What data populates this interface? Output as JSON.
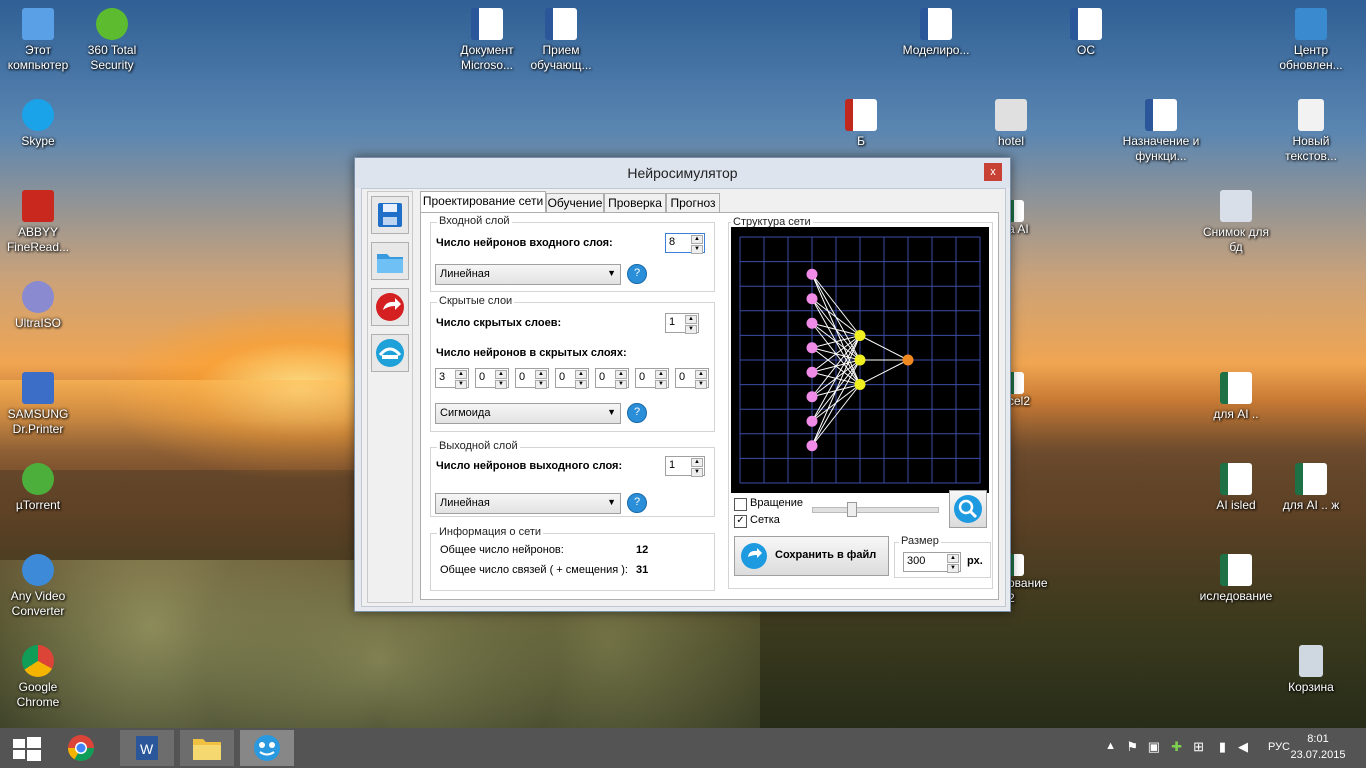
{
  "desktop": {
    "icons": [
      {
        "label": "Этот компьютер",
        "color": "#5aa0e6"
      },
      {
        "label": "360 Total Security",
        "color": "#5dbb2f"
      },
      {
        "label": "Skype",
        "color": "#1aa3e8"
      },
      {
        "label": "ABBYY FineRead...",
        "color": "#c8281e"
      },
      {
        "label": "UltraISO",
        "color": "#8a8ad0"
      },
      {
        "label": "SAMSUNG Dr.Printer",
        "color": "#3c6ec8"
      },
      {
        "label": "µTorrent",
        "color": "#4caf3c"
      },
      {
        "label": "Any Video Converter",
        "color": "#3c8ad8"
      },
      {
        "label": "Google Chrome",
        "color": "#e8b826"
      },
      {
        "label": "Документ Microso...",
        "color": "#2b579a"
      },
      {
        "label": "Прием обучающ...",
        "color": "#2b579a"
      },
      {
        "label": "Моделиро...",
        "color": "#2b579a"
      },
      {
        "label": "ОС",
        "color": "#2b579a"
      },
      {
        "label": "Центр обновлен...",
        "color": "#3a8ad0"
      },
      {
        "label": "Б",
        "color": "#c0281e"
      },
      {
        "label": "hotel",
        "color": "#e0e0e0"
      },
      {
        "label": "Назначение и функци...",
        "color": "#2b579a"
      },
      {
        "label": "Новый текстов...",
        "color": "#f2f2f2"
      },
      {
        "label": "Снимок для бд",
        "color": "#d8dfe8"
      },
      {
        "label": "для AI ..",
        "color": "#1e7145"
      },
      {
        "label": "AI isled",
        "color": "#1e7145"
      },
      {
        "label": "для AI .. ж",
        "color": "#1e7145"
      },
      {
        "label": "иследование",
        "color": "#1e7145"
      },
      {
        "label": "Корзина",
        "color": "#cfd8e0"
      },
      {
        "label": "a AI",
        "color": "#1e7145"
      },
      {
        "label": "cel2",
        "color": "#1e7145"
      },
      {
        "label": "ование 2",
        "color": "#1e7145"
      }
    ]
  },
  "window": {
    "title": "Нейросимулятор",
    "close": "x",
    "tabs": [
      "Проектирование сети",
      "Обучение",
      "Проверка",
      "Прогноз"
    ],
    "input_layer": {
      "group": "Входной слой",
      "neurons_label": "Число нейронов входного слоя:",
      "neurons_value": "8",
      "activation": "Линейная"
    },
    "hidden_layers": {
      "group": "Скрытые слои",
      "count_label": "Число скрытых слоев:",
      "count_value": "1",
      "neurons_label": "Число нейронов в скрытых слоях:",
      "neurons": [
        "3",
        "0",
        "0",
        "0",
        "0",
        "0",
        "0"
      ],
      "activation": "Сигмоида"
    },
    "output_layer": {
      "group": "Выходной слой",
      "neurons_label": "Число нейронов выходного слоя:",
      "neurons_value": "1",
      "activation": "Линейная"
    },
    "info": {
      "group": "Информация о сети",
      "total_neurons_label": "Общее число нейронов:",
      "total_neurons": "12",
      "total_links_label": "Общее число связей  ( + смещения ):",
      "total_links": "31"
    },
    "structure": {
      "group": "Структура сети",
      "rotation_label": "Вращение",
      "rotation_checked": false,
      "grid_label": "Сетка",
      "grid_checked": true,
      "save_label": "Сохранить в файл",
      "size_group": "Размер",
      "size_value": "300",
      "size_unit": "рх.",
      "layers": [
        8,
        3,
        1
      ],
      "colors": {
        "input": "#f08ce8",
        "hidden": "#f0f020",
        "output": "#f08a20",
        "grid": "#3d4da8",
        "links": "#ffffff"
      }
    }
  },
  "taskbar": {
    "lang": "РУС",
    "time": "8:01",
    "date": "23.07.2015"
  }
}
